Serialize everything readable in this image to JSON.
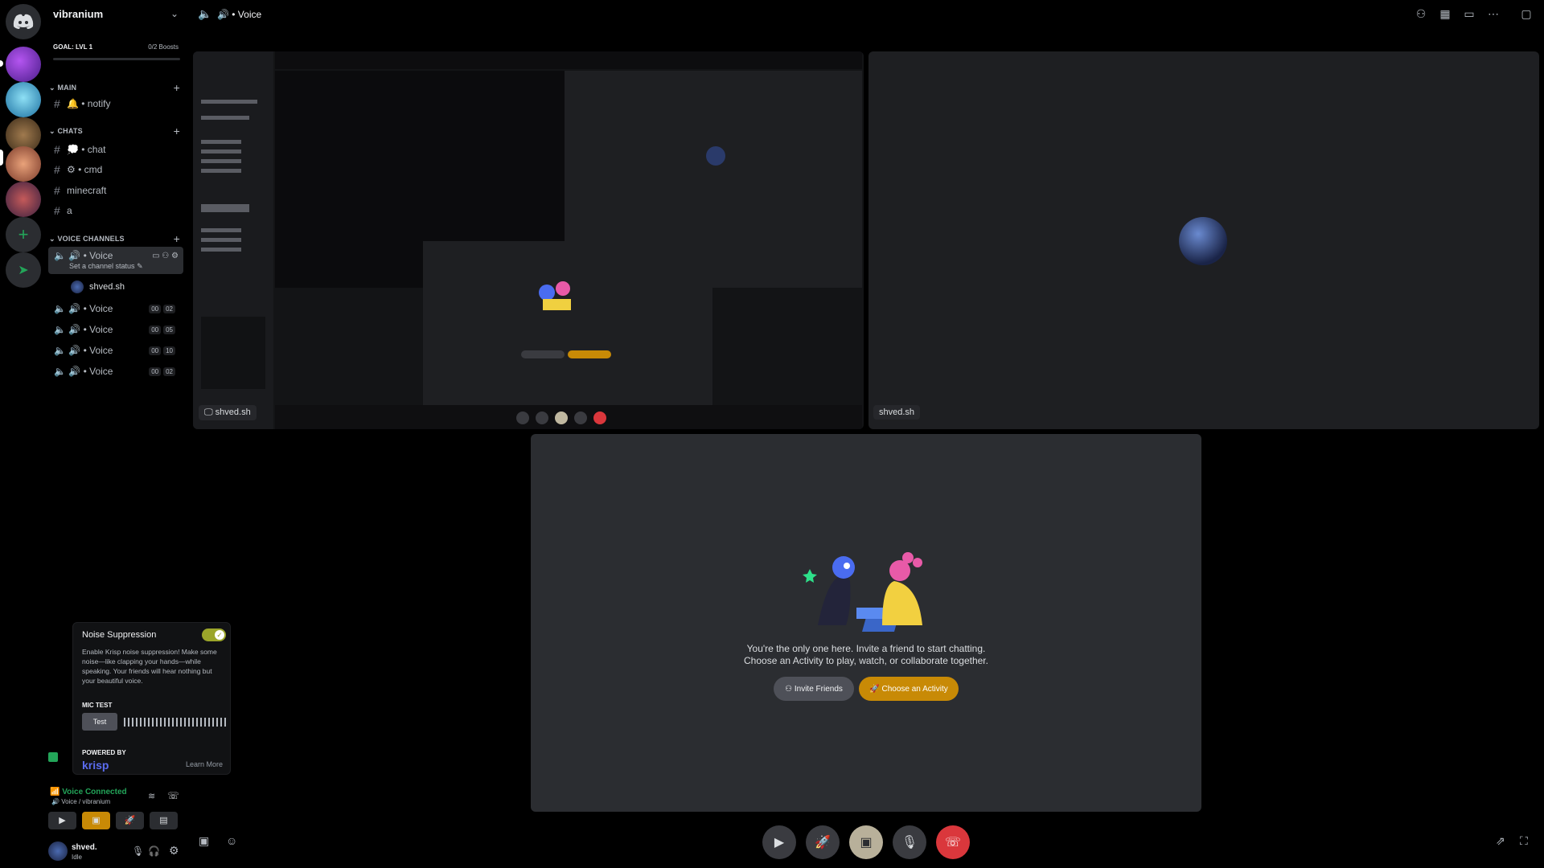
{
  "server": {
    "name": "vibranium",
    "goal_label": "GOAL: LVL 1",
    "boosts": "0/2 Boosts"
  },
  "categories": {
    "main": "MAIN",
    "chats": "CHATS",
    "voice": "VOICE CHANNELS"
  },
  "channels": {
    "notify": "🔔 • notify",
    "chat": "💭 • chat",
    "cmd": "⚙ • cmd",
    "minecraft": "minecraft",
    "a": "a"
  },
  "voice_channels": [
    {
      "label": "🔊 • Voice",
      "status": "Set a channel status",
      "member": "shved.sh"
    },
    {
      "label": "🔊 • Voice",
      "c1": "00",
      "c2": "02"
    },
    {
      "label": "🔊 • Voice",
      "c1": "00",
      "c2": "05"
    },
    {
      "label": "🔊 • Voice",
      "c1": "00",
      "c2": "10"
    },
    {
      "label": "🔊 • Voice",
      "c1": "00",
      "c2": "02"
    }
  ],
  "topbar": {
    "title": "🔊 • Voice"
  },
  "stage": {
    "screen_label": "shved.sh",
    "user_label": "shved.sh",
    "empty_line1": "You're the only one here. Invite a friend to start chatting.",
    "empty_line2": "Choose an Activity to play, watch, or collaborate together.",
    "invite_button": "Invite Friends",
    "activity_button": "Choose an Activity"
  },
  "noise_popover": {
    "title": "Noise Suppression",
    "body": "Enable Krisp noise suppression! Make some noise—like clapping your hands—while speaking. Your friends will hear nothing but your beautiful voice.",
    "mic_test": "MIC TEST",
    "test_button": "Test",
    "powered_by": "POWERED BY",
    "brand": "krisp",
    "learn_more": "Learn More"
  },
  "voice_status": {
    "title": "Voice Connected",
    "subtitle": "Voice / vibranium"
  },
  "user": {
    "name": "shved.",
    "status": "Idle"
  },
  "colors": {
    "accent": "#c88a06",
    "danger": "#da373c",
    "toggle": "#9ba52a"
  }
}
